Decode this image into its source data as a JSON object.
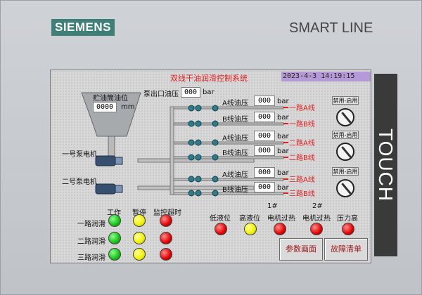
{
  "device": {
    "logo": "SIEMENS",
    "brand": "SMART LINE",
    "touch": "TOUCH"
  },
  "screen": {
    "title": "双线干油润滑控制系统",
    "datetime": "2023-4-3  14:19:15",
    "tank": {
      "label": "贮油筒油位",
      "value": "0000",
      "unit": "mm"
    },
    "pump_outlet": {
      "label": "泵出口油压",
      "value": "000",
      "unit": "bar"
    },
    "motors": [
      "一号泵电机",
      "二号泵电机"
    ],
    "lines": [
      {
        "label": "A线油压",
        "value": "000",
        "unit": "bar",
        "route": "一路A线"
      },
      {
        "label": "B线油压",
        "value": "000",
        "unit": "bar",
        "route": "一路B线"
      },
      {
        "label": "A线油压",
        "value": "000",
        "unit": "bar",
        "route": "二路A线"
      },
      {
        "label": "B线油压",
        "value": "000",
        "unit": "bar",
        "route": "二路B线"
      },
      {
        "label": "A线油压",
        "value": "000",
        "unit": "bar",
        "route": "三路A线"
      },
      {
        "label": "B线油压",
        "value": "000",
        "unit": "bar",
        "route": "三路B线"
      }
    ],
    "switch_label": "禁用-启用",
    "status": {
      "headers": [
        "工作",
        "暂停",
        "监控超时"
      ],
      "rows": [
        "一路润滑",
        "二路润滑",
        "三路润滑"
      ]
    },
    "alarms": {
      "labels": [
        "低液位",
        "高液位",
        "电机过热",
        "电机过热",
        "压力高"
      ],
      "motor_numbers": [
        "1#",
        "2#"
      ],
      "colors": [
        "red",
        "yellow",
        "red",
        "red",
        "red"
      ]
    },
    "buttons": {
      "params": "参数画面",
      "faults": "故障清单"
    }
  }
}
